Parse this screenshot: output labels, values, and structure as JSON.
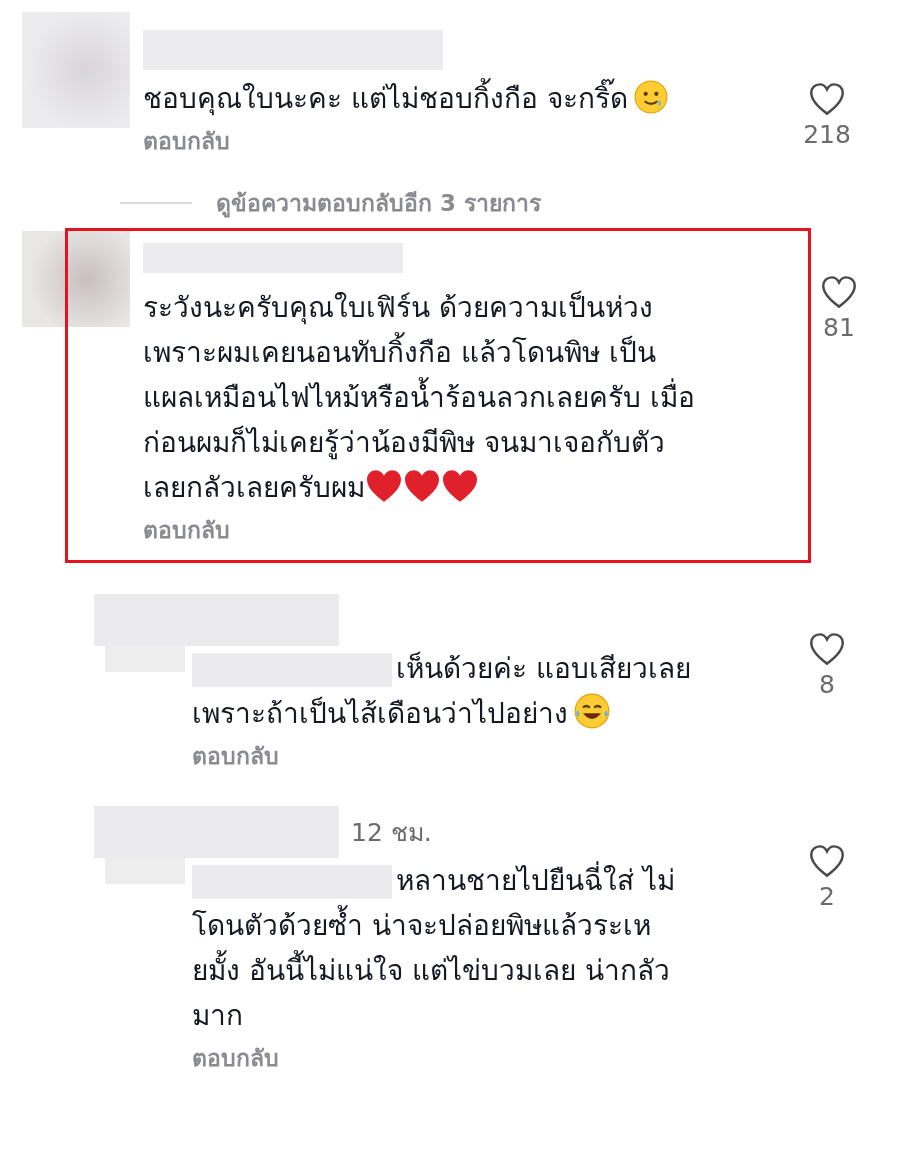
{
  "comments": [
    {
      "kind": "comment",
      "highlighted": false,
      "text": "ชอบคุณใบนะคะ แต่ไม่ชอบกิ้งกือ จะกริ๊ด",
      "emoji": [
        {
          "kind": "smile-tear"
        }
      ],
      "reply": "ตอบกลับ",
      "likes": "218",
      "view_replies": "ดูข้อความตอบกลับอีก 3 รายการ"
    },
    {
      "kind": "comment",
      "highlighted": true,
      "text": "ระวังนะครับคุณใบเฟิร์น ด้วยความเป็นห่วง\nเพราะผมเคยนอนทับกิ้งกือ แล้วโดนพิษ เป็น\nแผลเหมือนไฟไหม้หรือน้ำร้อนลวกเลยครับ เมื่อ\nก่อนผมก็ไม่เคยรู้ว่าน้องมีพิษ จนมาเจอกับตัว\nเลยกลัวเลยครับผม",
      "emoji": [
        {
          "kind": "heart"
        },
        {
          "kind": "heart"
        },
        {
          "kind": "heart"
        }
      ],
      "reply": "ตอบกลับ",
      "likes": "81"
    },
    {
      "kind": "reply",
      "highlighted": false,
      "text": "เห็นด้วยค่ะ แอบเสียวเลย\nเพราะถ้าเป็นไส้เดือนว่าไปอย่าง",
      "emoji": [
        {
          "kind": "laugh"
        }
      ],
      "reply": "ตอบกลับ",
      "likes": "8"
    },
    {
      "kind": "reply",
      "highlighted": false,
      "time": "12 ชม.",
      "text": "หลานชายไปยืนฉี่ใส่ ไม่\nโดนตัวด้วยซ้ำ น่าจะปล่อยพิษแล้วระเห\nยมั้ง อันนี้ไม่แน่ใจ แต่ไข่บวมเลย น่ากลัว\nมาก",
      "reply": "ตอบกลับ",
      "likes": "2"
    }
  ]
}
